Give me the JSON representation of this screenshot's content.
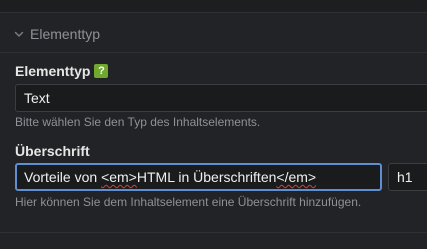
{
  "section": {
    "legend": "Elementtyp"
  },
  "element_type": {
    "label": "Elementtyp",
    "help_badge": "?",
    "value": "Text",
    "hint": "Bitte wählen Sie den Typ des Inhaltselements."
  },
  "heading": {
    "label": "Überschrift",
    "value_before": "Vorteile von ",
    "value_flagged_1": "<em>",
    "value_middle": "HTML in Überschriften",
    "value_flagged_2": "</em>",
    "value_after": "",
    "level": "h1",
    "hint": "Hier können Sie dem Inhaltselement eine Überschrift hinzufügen."
  },
  "colors": {
    "background": "#222326",
    "focus_border": "#5f8ed2",
    "help_badge": "#6fa92d",
    "spellcheck": "#d0443a"
  }
}
